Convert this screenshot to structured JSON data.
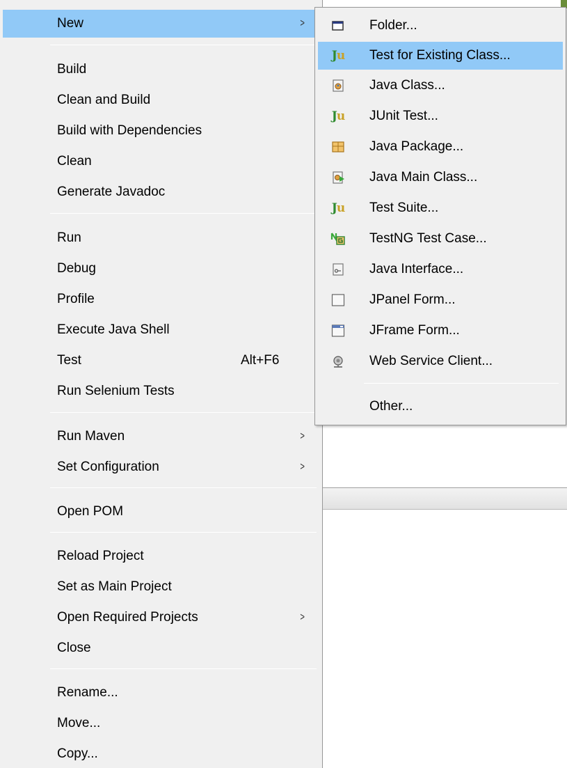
{
  "main_menu": {
    "items": [
      {
        "label": "New",
        "has_submenu": true,
        "highlighted": true
      },
      {
        "label": "Build"
      },
      {
        "label": "Clean and Build"
      },
      {
        "label": "Build with Dependencies"
      },
      {
        "label": "Clean"
      },
      {
        "label": "Generate Javadoc"
      },
      {
        "label": "Run"
      },
      {
        "label": "Debug"
      },
      {
        "label": "Profile"
      },
      {
        "label": "Execute Java Shell"
      },
      {
        "label": "Test",
        "shortcut": "Alt+F6"
      },
      {
        "label": "Run Selenium Tests"
      },
      {
        "label": "Run Maven",
        "has_submenu": true
      },
      {
        "label": "Set Configuration",
        "has_submenu": true
      },
      {
        "label": "Open POM"
      },
      {
        "label": "Reload Project"
      },
      {
        "label": "Set as Main Project"
      },
      {
        "label": "Open Required Projects",
        "has_submenu": true
      },
      {
        "label": "Close"
      },
      {
        "label": "Rename..."
      },
      {
        "label": "Move..."
      },
      {
        "label": "Copy..."
      }
    ],
    "arrow_glyph": ">"
  },
  "submenu": {
    "items": [
      {
        "label": "Folder...",
        "icon": "folder-icon"
      },
      {
        "label": "Test for Existing Class...",
        "icon": "junit-icon",
        "highlighted": true
      },
      {
        "label": "Java Class...",
        "icon": "java-class-icon"
      },
      {
        "label": "JUnit Test...",
        "icon": "junit-icon"
      },
      {
        "label": "Java Package...",
        "icon": "java-package-icon"
      },
      {
        "label": "Java Main Class...",
        "icon": "java-main-class-icon"
      },
      {
        "label": "Test Suite...",
        "icon": "junit-icon"
      },
      {
        "label": "TestNG Test Case...",
        "icon": "testng-icon"
      },
      {
        "label": "Java Interface...",
        "icon": "java-interface-icon"
      },
      {
        "label": "JPanel Form...",
        "icon": "jpanel-icon"
      },
      {
        "label": "JFrame Form...",
        "icon": "jframe-icon"
      },
      {
        "label": "Web Service Client...",
        "icon": "web-service-icon"
      },
      {
        "label": "Other..."
      }
    ]
  },
  "colors": {
    "menu_bg": "#f0f0f0",
    "highlight": "#91c9f7",
    "junit_green": "#2f8a2f"
  }
}
